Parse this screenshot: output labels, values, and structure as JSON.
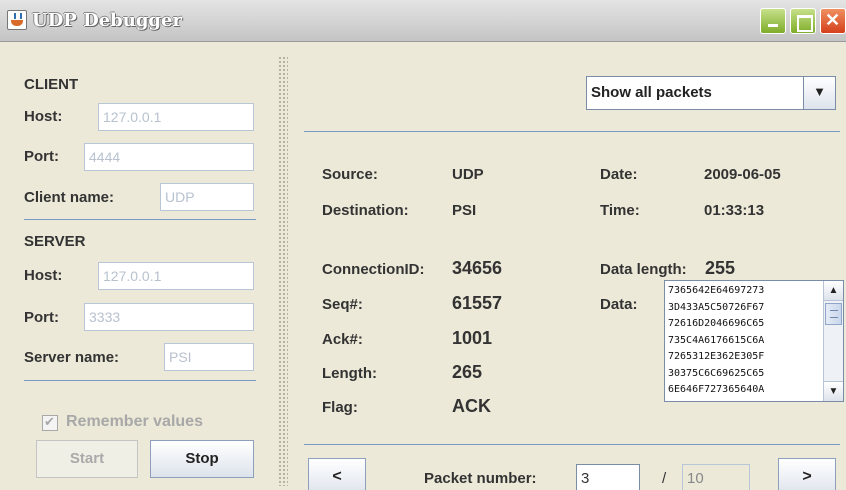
{
  "window": {
    "title": "UDP Debugger"
  },
  "client": {
    "section": "CLIENT",
    "host_label": "Host:",
    "host_value": "127.0.0.1",
    "port_label": "Port:",
    "port_value": "4444",
    "name_label": "Client name:",
    "name_value": "UDP"
  },
  "server": {
    "section": "SERVER",
    "host_label": "Host:",
    "host_value": "127.0.0.1",
    "port_label": "Port:",
    "port_value": "3333",
    "name_label": "Server name:",
    "name_value": "PSI"
  },
  "options": {
    "remember_label": "Remember values",
    "remember_checked": true
  },
  "actions": {
    "start_label": "Start",
    "stop_label": "Stop"
  },
  "filter": {
    "selected": "Show all packets",
    "arrow": "▼"
  },
  "packet": {
    "source_label": "Source:",
    "source_value": "UDP",
    "destination_label": "Destination:",
    "destination_value": "PSI",
    "date_label": "Date:",
    "date_value": "2009-06-05",
    "time_label": "Time:",
    "time_value": "01:33:13",
    "connection_label": "ConnectionID:",
    "connection_value": "34656",
    "seq_label": "Seq#:",
    "seq_value": "61557",
    "ack_label": "Ack#:",
    "ack_value": "1001",
    "length_label": "Length:",
    "length_value": "265",
    "flag_label": "Flag:",
    "flag_value": "ACK",
    "data_length_label": "Data length:",
    "data_length_value": "255",
    "data_label": "Data:",
    "data_lines": [
      "7365642E64697273",
      "3D433A5C50726F67",
      "72616D2046696C65",
      "735C4A6176615C6A",
      "7265312E362E305F",
      "30375C6C69625C65",
      "6E646F727365640A"
    ]
  },
  "navigation": {
    "prev_label": "<",
    "next_label": ">",
    "packet_number_label": "Packet number:",
    "current": "3",
    "separator": "/",
    "total": "10"
  }
}
